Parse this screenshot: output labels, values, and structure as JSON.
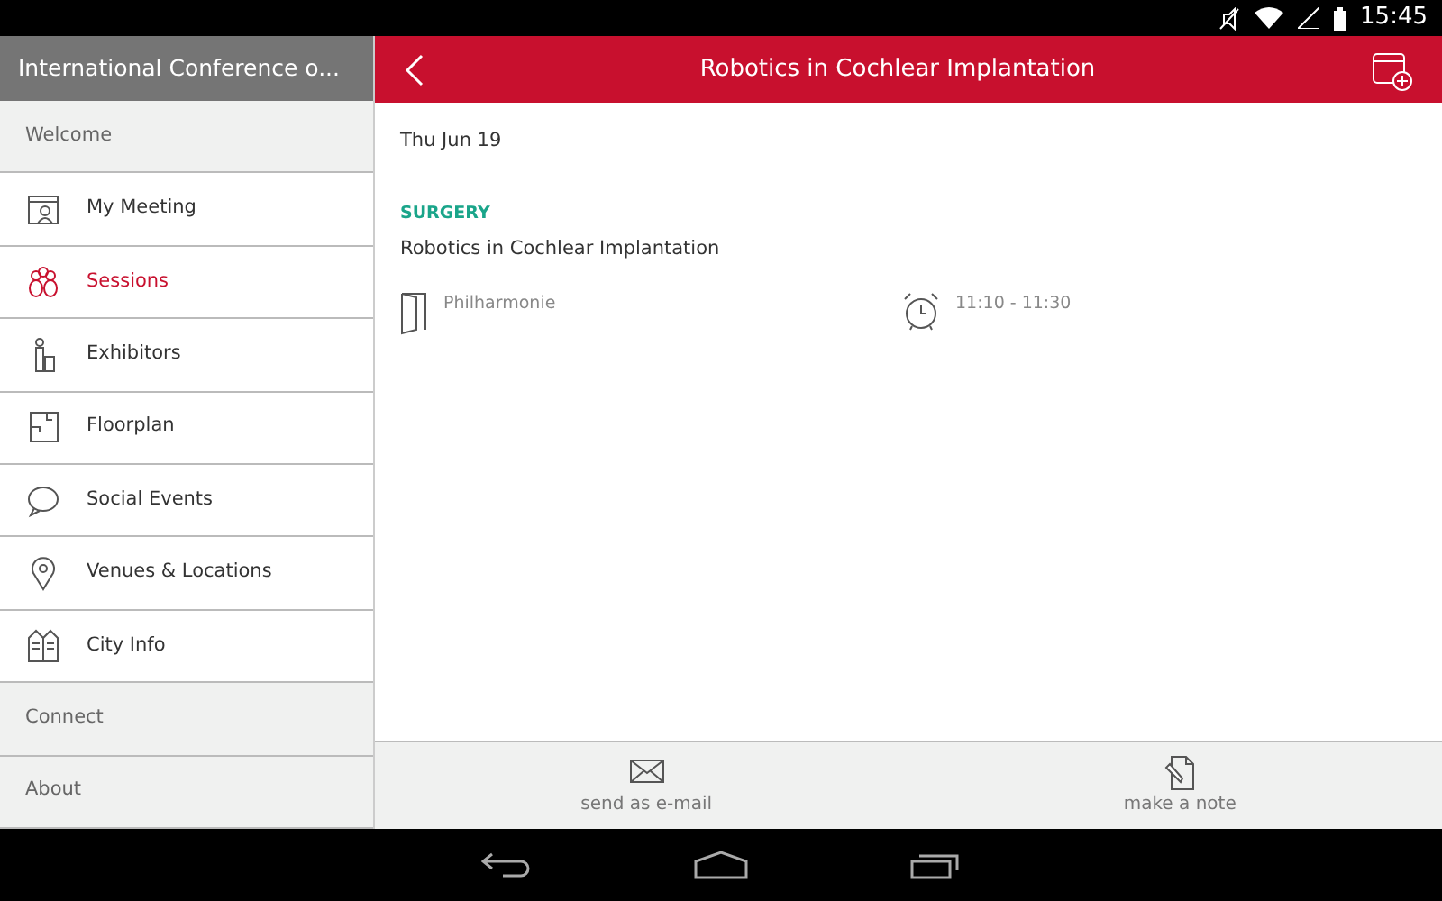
{
  "status_bar": {
    "time": "15:45"
  },
  "sidebar": {
    "title": "International Conference o...",
    "items": [
      {
        "kind": "section",
        "label": "Welcome"
      },
      {
        "kind": "item",
        "label": "My Meeting",
        "selected": false
      },
      {
        "kind": "item",
        "label": "Sessions",
        "selected": true
      },
      {
        "kind": "item",
        "label": "Exhibitors",
        "selected": false
      },
      {
        "kind": "item",
        "label": "Floorplan",
        "selected": false
      },
      {
        "kind": "item",
        "label": "Social Events",
        "selected": false
      },
      {
        "kind": "item",
        "label": "Venues & Locations",
        "selected": false
      },
      {
        "kind": "item",
        "label": "City Info",
        "selected": false
      },
      {
        "kind": "section",
        "label": "Connect"
      },
      {
        "kind": "section",
        "label": "About"
      }
    ]
  },
  "header": {
    "title": "Robotics in Cochlear Implantation"
  },
  "session": {
    "date": "Thu Jun 19",
    "category": "SURGERY",
    "title": "Robotics in Cochlear Implantation",
    "room": "Philharmonie",
    "time": "11:10 - 11:30"
  },
  "actions": [
    {
      "label": "send as e-mail"
    },
    {
      "label": "make a note"
    }
  ]
}
